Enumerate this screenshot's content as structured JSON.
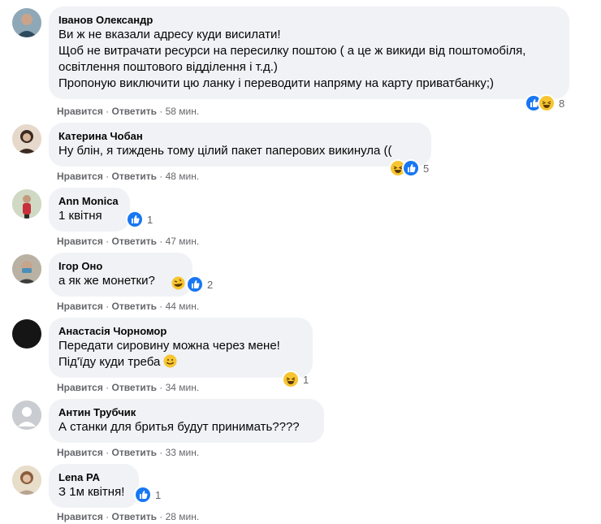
{
  "comments": [
    {
      "author": "Іванов Олександр",
      "text": "Ви ж не вказали адресу куди висилати!\nЩоб не витрачати ресурси на пересилку поштою ( а це ж викиди від поштомобіля, освітлення поштового відділення і т.д.)\nПропоную виключити цю ланку і переводити напряму на карту приватбанку;)",
      "like": "Нравится",
      "reply": "Ответить",
      "sep": " · ",
      "time": "58 мин.",
      "reactions": [
        "like-icon",
        "haha-icon"
      ],
      "reaction_count": "8"
    },
    {
      "author": "Катерина Чобан",
      "text": "Ну блін, я тиждень тому цілий пакет паперових викинула ((",
      "like": "Нравится",
      "reply": "Ответить",
      "sep": " · ",
      "time": "48 мин.",
      "reactions": [
        "haha-icon",
        "like-icon"
      ],
      "reaction_count": "5"
    },
    {
      "author": "Ann Monica",
      "text": "1 квітня",
      "like": "Нравится",
      "reply": "Ответить",
      "sep": " · ",
      "time": "47 мин.",
      "reactions": [
        "like-icon"
      ],
      "reaction_count": "1"
    },
    {
      "author": "Ігор Оно",
      "text": "а як же монетки?",
      "like": "Нравится",
      "reply": "Ответить",
      "sep": " · ",
      "time": "44 мин.",
      "reactions": [
        "like-icon"
      ],
      "reaction_count": "2"
    },
    {
      "author": "Анастасія Чорномор",
      "text": "Передати сировину можна через мене!\nПід'їду куди треба",
      "like": "Нравится",
      "reply": "Ответить",
      "sep": " · ",
      "time": "34 мин.",
      "reactions": [
        "haha-icon"
      ],
      "reaction_count": "1"
    },
    {
      "author": "Антин Трубчик",
      "text": "А станки для бритья будут принимать????",
      "like": "Нравится",
      "reply": "Ответить",
      "sep": " · ",
      "time": "33 мин.",
      "reactions": [],
      "reaction_count": ""
    },
    {
      "author": "Lena PA",
      "text": "З 1м квітня!",
      "like": "Нравится",
      "reply": "Ответить",
      "sep": " · ",
      "time": "28 мин.",
      "reactions": [
        "like-icon"
      ],
      "reaction_count": "1"
    }
  ],
  "colors": {
    "bubble": "#f0f2f5",
    "meta": "#65676b",
    "like": "#1877f2",
    "haha": "#f7c531"
  }
}
